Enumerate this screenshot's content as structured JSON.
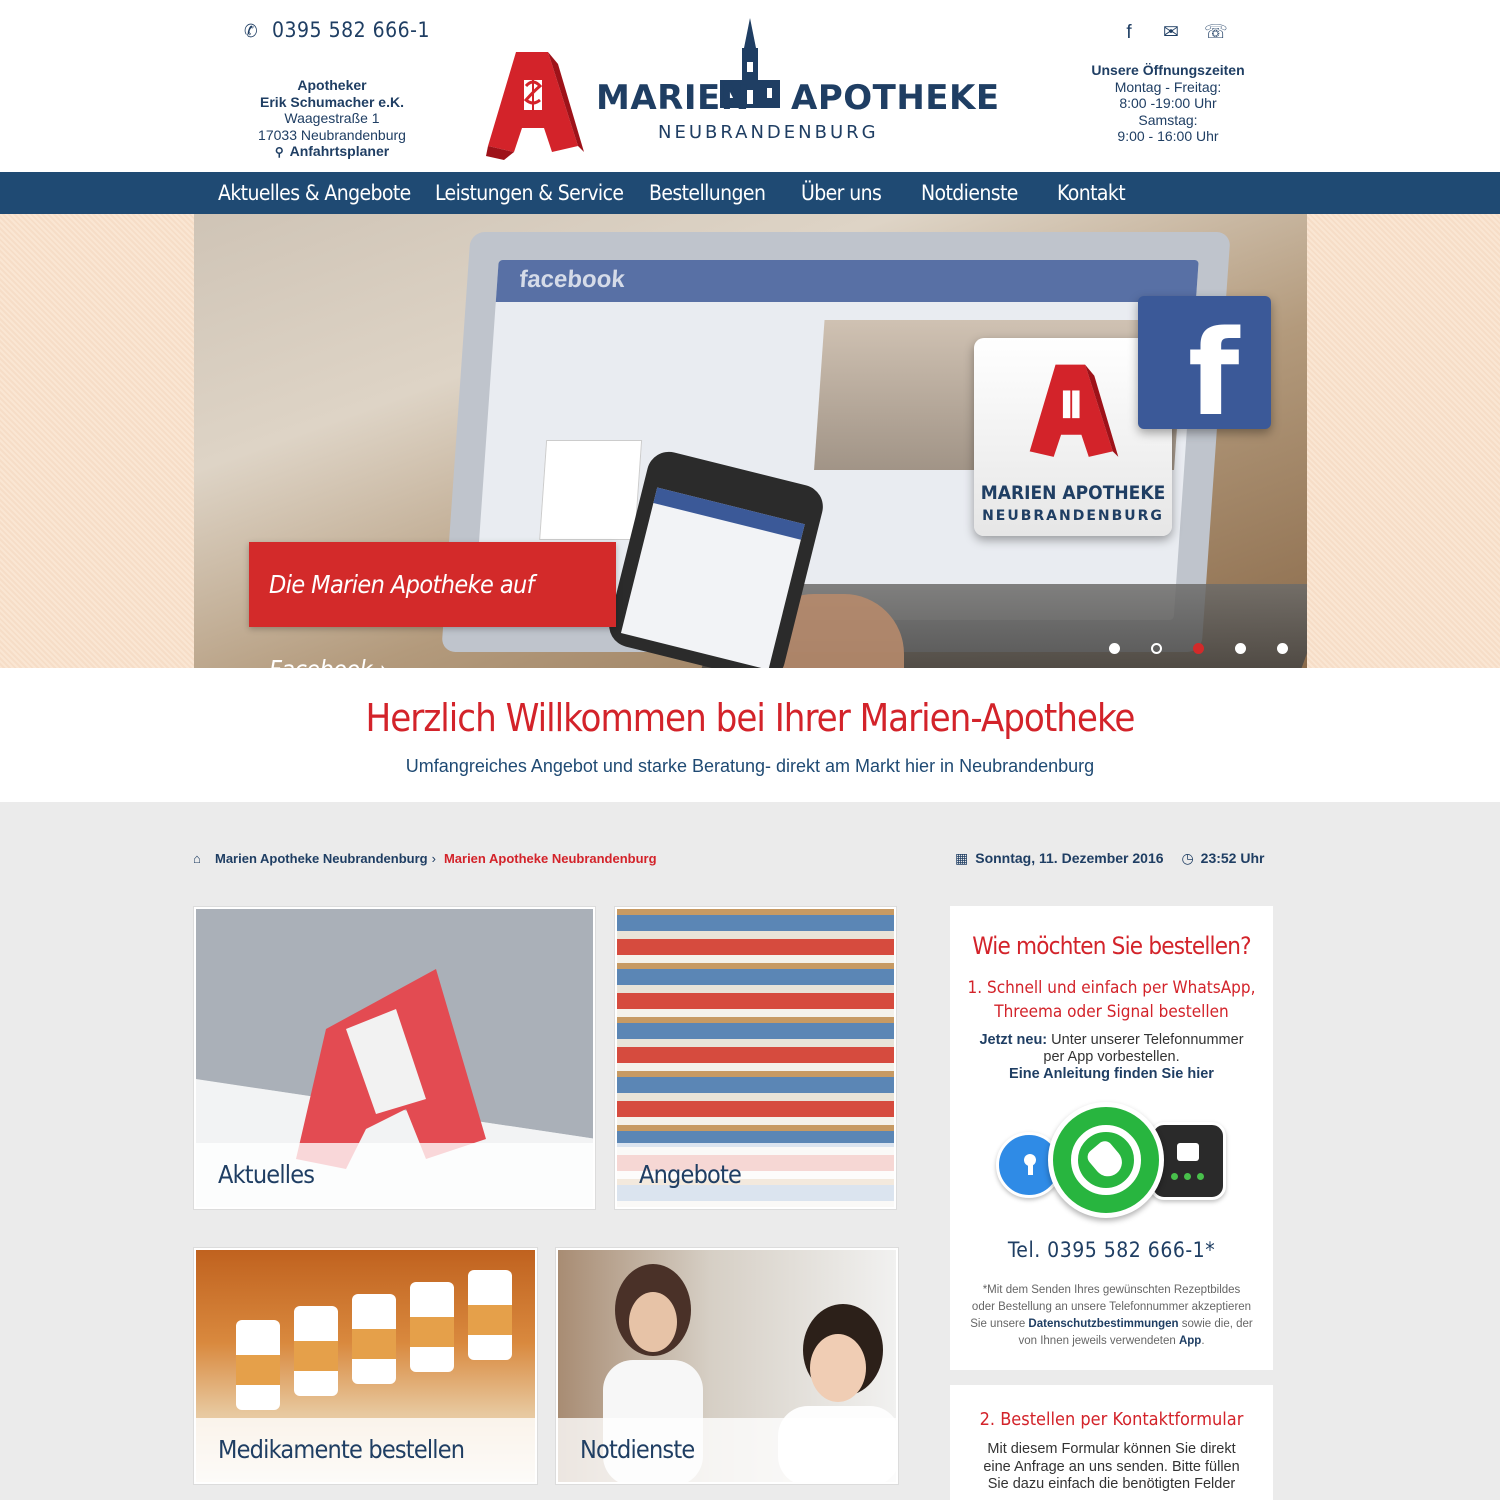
{
  "header": {
    "phone": "0395 582 666-1",
    "address": {
      "line1": "Apotheker",
      "line2": "Erik Schumacher e.K.",
      "line3": "Waagestraße 1",
      "line4": "17033 Neubrandenburg",
      "route_label": "Anfahrtsplaner"
    },
    "logo": {
      "word1": "MARIEN",
      "word2": "APOTHEKE",
      "sub": "NEUBRANDENBURG"
    },
    "hours": {
      "title": "Unsere Öffnungszeiten",
      "line1": "Montag - Freitag:",
      "line2": "8:00 -19:00 Uhr",
      "line3": "Samstag:",
      "line4": "9:00 - 16:00 Uhr"
    }
  },
  "nav": {
    "items": [
      {
        "label": "Aktuelles & Angebote"
      },
      {
        "label": "Leistungen & Service"
      },
      {
        "label": "Bestellungen"
      },
      {
        "label": "Über uns"
      },
      {
        "label": "Notdienste"
      },
      {
        "label": "Kontakt"
      }
    ]
  },
  "hero": {
    "screen_title": "facebook",
    "tile_line1": "MARIEN APOTHEKE",
    "tile_line2": "NEUBRANDENBURG",
    "cta_label": "Die Marien Apotheke auf Facebook ›",
    "slides": 5,
    "active_slide": 3,
    "colors": {
      "accent": "#d32a2a",
      "facebook": "#3b5998"
    }
  },
  "welcome": {
    "title": "Herzlich Willkommen bei Ihrer Marien-Apotheke",
    "subtitle": "Umfangreiches Angebot und starke Beratung- direkt am Markt hier in Neubrandenburg"
  },
  "breadcrumb": {
    "home": "Marien Apotheke Neubrandenburg",
    "current": "Marien Apotheke Neubrandenburg"
  },
  "datetime": {
    "date": "Sonntag, 11. Dezember 2016",
    "time": "23:52 Uhr"
  },
  "tiles": {
    "aktuelles": "Aktuelles",
    "angebote": "Angebote",
    "medikamente": "Medikamente bestellen",
    "notdienste": "Notdienste"
  },
  "order_box": {
    "title": "Wie möchten Sie bestellen?",
    "step1": "1. Schnell und einfach per WhatsApp, Threema oder Signal bestellen",
    "new_label": "Jetzt neu:",
    "new_text": " Unter unserer Telefonnummer per App vorbestellen.",
    "guide_link": "Eine Anleitung finden Sie hier",
    "phone": "Tel. 0395 582 666-1*",
    "note_part1": "*Mit dem Senden Ihres gewünschten Rezeptbildes oder Bestellung an unsere Telefonnummer akzeptieren Sie unsere ",
    "note_link1": "Datenschutzbestimmungen",
    "note_part2": " sowie die, der von Ihnen jeweils verwendeten ",
    "note_link2": "App",
    "note_part3": "."
  },
  "contact_box": {
    "title": "2. Bestellen per Kontaktformular",
    "text": "Mit diesem Formular können Sie direkt eine Anfrage an uns senden. Bitte füllen Sie dazu einfach die benötigten Felder"
  }
}
